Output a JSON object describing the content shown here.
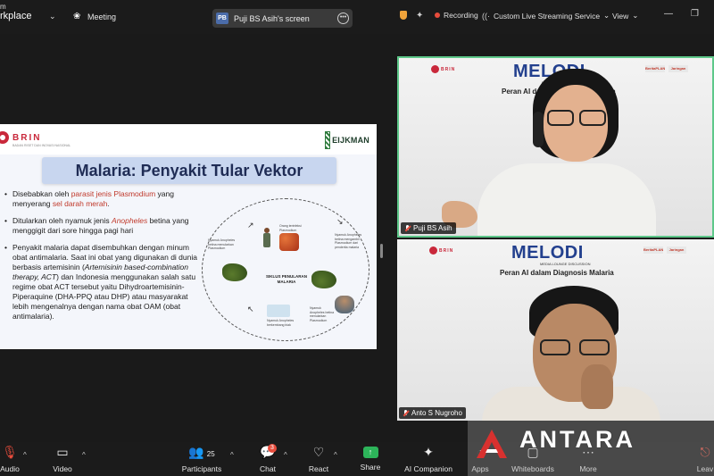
{
  "app": {
    "brand_top": "m",
    "brand": "rkplace",
    "meeting_label": "Meeting"
  },
  "screen_share": {
    "initials": "PB",
    "label": "Puji BS Asih's screen"
  },
  "status": {
    "recording": "Recording",
    "streaming": "Custom Live Streaming Service",
    "view": "View"
  },
  "slide": {
    "org": "BRIN",
    "org_sub": "BADAN RISET DAN INOVASI NASIONAL",
    "partner": "EIJKMAN",
    "title": "Malaria: Penyakit Tular Vektor",
    "bullet1_a": "Disebabkan oleh ",
    "bullet1_b": "parasit jenis Plasmodium",
    "bullet1_c": " yang menyerang ",
    "bullet1_d": "sel darah merah",
    "bullet1_e": ".",
    "bullet2_a": "Ditularkan oleh nyamuk jenis ",
    "bullet2_b": "Anopheles",
    "bullet2_c": " betina yang menggigit dari sore hingga pagi hari",
    "bullet3_a": "Penyakit malaria dapat disembuhkan dengan minum obat antimalaria. Saat ini obat yang digunakan di dunia berbasis artemisinin (",
    "bullet3_b": "Artemisinin based-combination therapy, ACT",
    "bullet3_c": ") dan Indonesia menggunakan salah satu regime obat ACT tersebut yaitu  Dihydroartemisinin-Piperaquine (DHA-PPQ atau DHP) atau masyarakat lebih mengenalnya dengan nama obat OAM (obat antimalaria).",
    "cycle_center": "SIKLUS PENULARAN MALARIA",
    "note_top": "Orang terinfeksi Plasmodium",
    "note_left": "Nyamuk Anopheles betina menularkan Plasmodium",
    "note_right": "Nyamuk Anopheles betina mengambil Plasmodium dari penderita malaria",
    "note_br": "Nyamuk Anopheles betina menularkan Plasmodium",
    "note_bottom": "Nyamuk Anopheles berkembang biak"
  },
  "tiles": [
    {
      "name": "Puji BS Asih",
      "banner": "MELODI",
      "banner_sub": "MEDIA LOUNGE DISCUSSION",
      "topic": "Peran AI dalam Diagnosis Malaria"
    },
    {
      "name": "Anto S Nugroho",
      "banner": "MELODI",
      "banner_sub": "MEDIA LOUNGE DISCUSSION",
      "topic": "Peran AI dalam Diagnosis Malaria"
    }
  ],
  "backdrop_brin": "BRIN",
  "backdrop_right": [
    "BeritaPLAN",
    "Jaringan"
  ],
  "toolbar": {
    "audio": "Audio",
    "video": "Video",
    "participants": "Participants",
    "participants_count": "25",
    "chat": "Chat",
    "chat_badge": "3",
    "react": "React",
    "share": "Share",
    "ai": "AI Companion",
    "apps": "Apps",
    "whiteboards": "Whiteboards",
    "more": "More",
    "leave": "Leav"
  },
  "watermark": "ANTARA",
  "colors": {
    "accent_green": "#2db45a",
    "recording_red": "#e74c3c",
    "brin_red": "#c9283b",
    "melodi_blue": "#23408e"
  }
}
